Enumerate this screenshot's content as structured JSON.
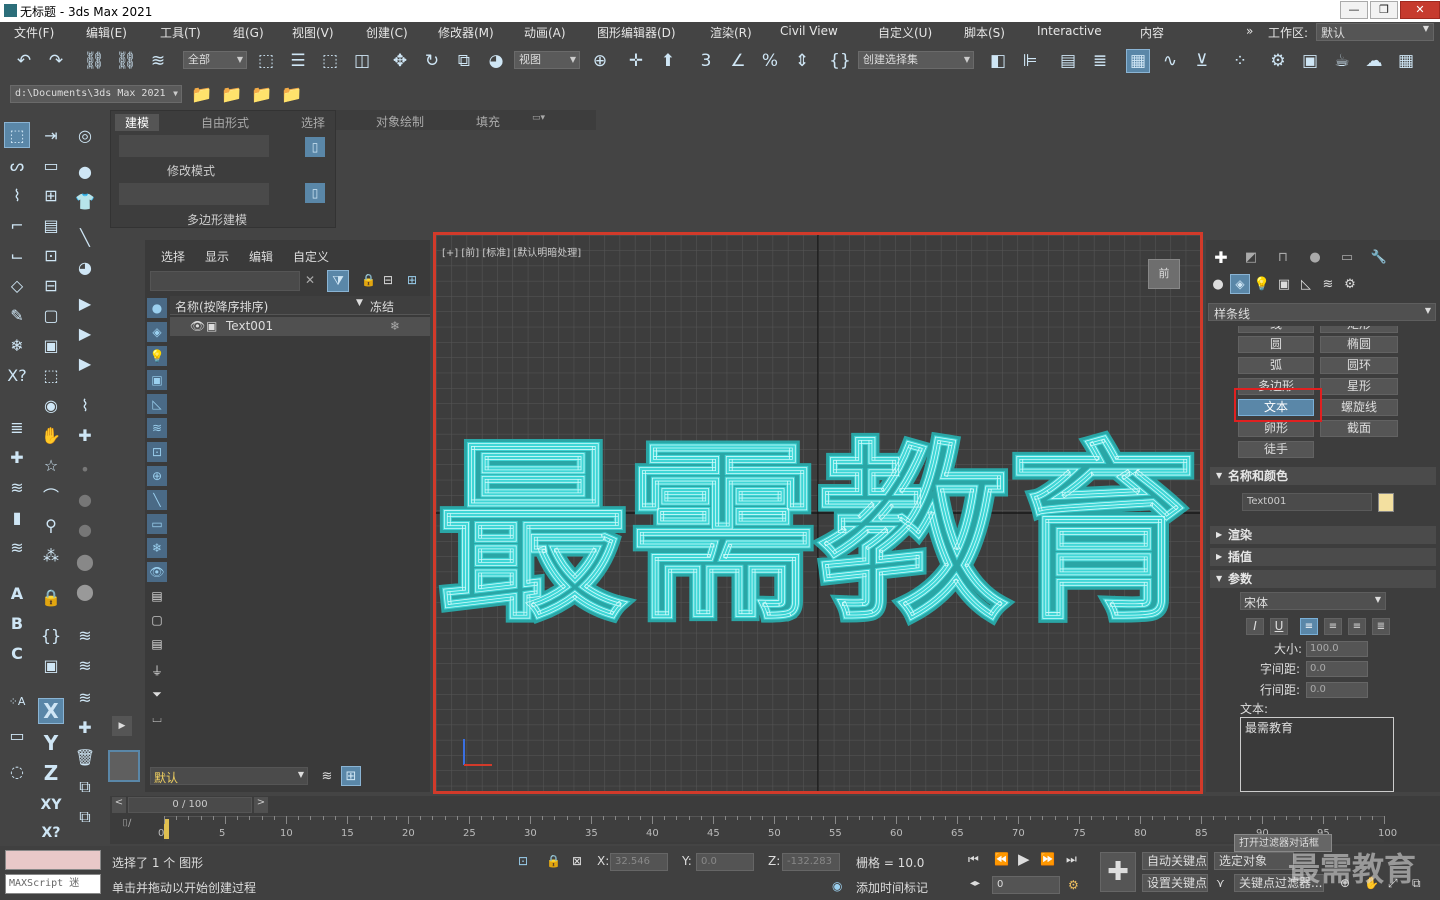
{
  "window": {
    "title": "无标题 - 3ds Max 2021",
    "min_label": "—",
    "max_label": "❐",
    "close_label": "✕"
  },
  "menu": {
    "items": [
      "文件(F)",
      "编辑(E)",
      "工具(T)",
      "组(G)",
      "视图(V)",
      "创建(C)",
      "修改器(M)",
      "动画(A)",
      "图形编辑器(D)",
      "渲染(R)",
      "Civil View",
      "自定义(U)",
      "脚本(S)",
      "Interactive",
      "内容"
    ],
    "overflow": "»",
    "workspace_label": "工作区:",
    "workspace_value": "默认"
  },
  "toolbar": {
    "selection_filter": "全部",
    "ref_coord": "视图",
    "named_selection": "创建选择集",
    "project_path": "d:\\Documents\\3ds Max 2021"
  },
  "ribbon": {
    "tabs": [
      "建模",
      "自由形式",
      "选择",
      "对象绘制",
      "填充"
    ],
    "mode_label": "修改模式",
    "section_label": "多边形建模"
  },
  "scene_explorer": {
    "menu": [
      "选择",
      "显示",
      "编辑",
      "自定义"
    ],
    "col_name": "名称(按降序排序)",
    "col_freeze": "冻结",
    "rows": [
      {
        "name": "Text001",
        "freeze_icon": "❄"
      }
    ],
    "layer_combo": "默认"
  },
  "viewport": {
    "label": "[+] [前] [标准] [默认明暗处理]",
    "text": "最需教育",
    "text_color": "#3fd6d6",
    "nav_cube": "前"
  },
  "command_panel": {
    "category": "样条线",
    "buttons": [
      "线",
      "矩形",
      "圆",
      "椭圆",
      "弧",
      "圆环",
      "多边形",
      "星形",
      "文本",
      "螺旋线",
      "卵形",
      "截面",
      "徒手"
    ],
    "active_button": "文本",
    "rollout_name_color": "名称和颜色",
    "object_name": "Text001",
    "object_color": "#f3e0a0",
    "rollout_render": "渲染",
    "rollout_interp": "插值",
    "rollout_params": "参数",
    "font": "宋体",
    "italic": "I",
    "underline": "U",
    "size_label": "大小:",
    "size_value": "100.0",
    "kerning_label": "字间距:",
    "kerning_value": "0.0",
    "leading_label": "行间距:",
    "leading_value": "0.0",
    "text_label": "文本:",
    "text_value": "最需教育"
  },
  "timeline": {
    "frame_display": "0 / 100",
    "ticks": [
      "0",
      "5",
      "10",
      "15",
      "20",
      "25",
      "30",
      "35",
      "40",
      "45",
      "50",
      "55",
      "60",
      "65",
      "70",
      "75",
      "80",
      "85",
      "90",
      "95",
      "100"
    ],
    "filter_tooltip": "打开过滤器对话框"
  },
  "status": {
    "maxscript": "MAXScript 迷",
    "selected": "选择了 1 个 图形",
    "prompt": "单击并拖动以开始创建过程",
    "x_label": "X:",
    "x_value": "32.546",
    "y_label": "Y:",
    "y_value": "0.0",
    "z_label": "Z:",
    "z_value": "-132.283",
    "grid": "栅格 = 10.0",
    "add_time_tag": "添加时间标记",
    "auto_key": "自动关键点",
    "set_key": "设置关键点",
    "selected_obj": "选定对象",
    "key_filters": "关键点过滤器...",
    "frame": "0",
    "watermark": "最需教育"
  }
}
